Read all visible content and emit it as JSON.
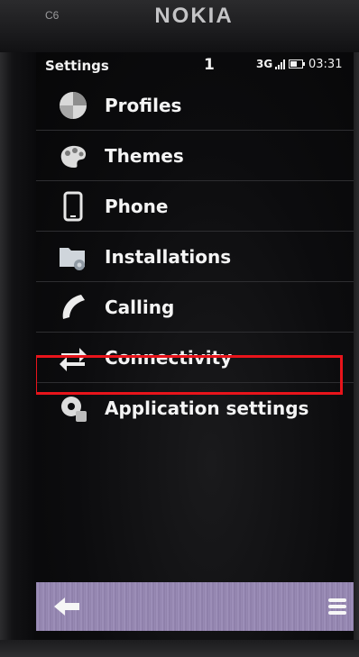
{
  "device": {
    "model": "C6",
    "brand": "NOKIA"
  },
  "status_bar": {
    "title": "Settings",
    "notification_count": "1",
    "network": "3G",
    "time": "03:31"
  },
  "menu": {
    "items": [
      {
        "label": "Profiles",
        "icon": "profiles-icon"
      },
      {
        "label": "Themes",
        "icon": "themes-icon"
      },
      {
        "label": "Phone",
        "icon": "phone-icon"
      },
      {
        "label": "Installations",
        "icon": "installations-icon"
      },
      {
        "label": "Calling",
        "icon": "calling-icon"
      },
      {
        "label": "Connectivity",
        "icon": "connectivity-icon"
      },
      {
        "label": "Application settings",
        "icon": "application-settings-icon"
      }
    ],
    "highlighted_index": 5
  },
  "toolbar": {
    "back_icon": "back-arrow-icon",
    "options_icon": "options-menu-icon"
  },
  "colors": {
    "highlight": "#e8141b",
    "toolbar": "#9a8cb5",
    "screen_background": "#0b0b0d"
  }
}
